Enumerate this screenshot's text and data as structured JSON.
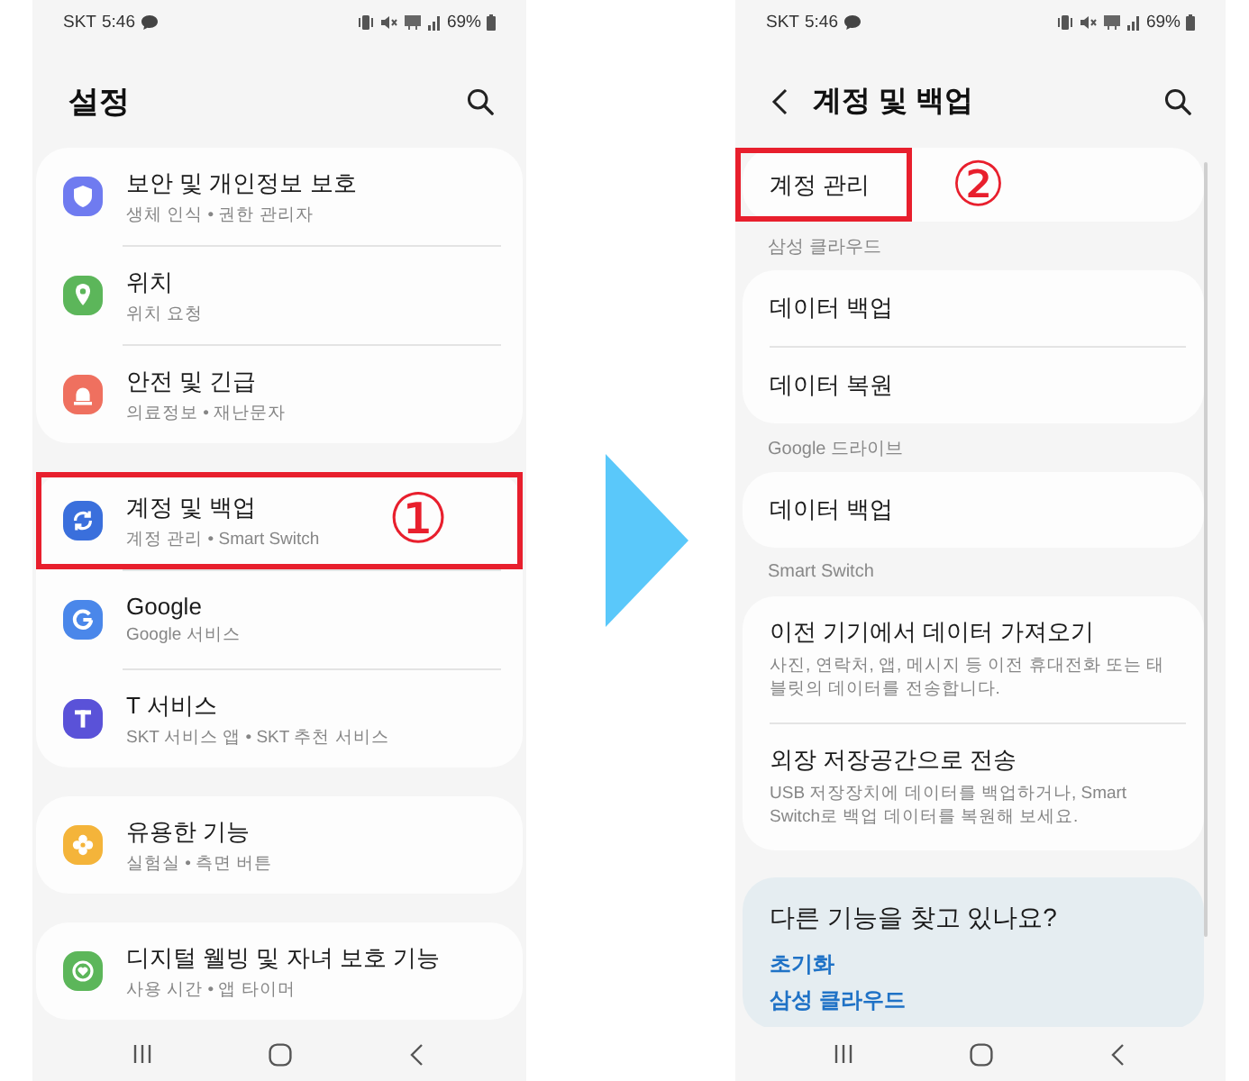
{
  "screens": [
    {
      "kind": "main",
      "status_bar": {
        "carrier": "SKT",
        "time": "5:46",
        "battery": "69%"
      },
      "title": "설정",
      "groups": [
        {
          "items": [
            {
              "title": "보안 및 개인정보 보호",
              "subtitle": "생체 인식 • 권한 관리자",
              "color": "#6f7bf0",
              "highlighted": false
            },
            {
              "title": "위치",
              "subtitle": "위치 요청",
              "color": "#5cb65a",
              "highlighted": false
            },
            {
              "title": "안전 및 긴급",
              "subtitle": "의료정보 • 재난문자",
              "color": "#ef705f",
              "highlighted": false
            }
          ]
        },
        {
          "items": [
            {
              "title": "계정 및 백업",
              "subtitle": "계정 관리 • Smart Switch",
              "color": "#3a6fdc",
              "highlighted": true,
              "step": "①"
            },
            {
              "title": "Google",
              "subtitle": "Google 서비스",
              "color": "#4a87ea",
              "highlighted": false
            },
            {
              "title": "T 서비스",
              "subtitle": "SKT 서비스 앱 • SKT 추천 서비스",
              "color": "#5a52d8",
              "highlighted": false
            }
          ]
        },
        {
          "items": [
            {
              "title": "유용한 기능",
              "subtitle": "실험실 • 측면 버튼",
              "color": "#f4b43a",
              "highlighted": false
            }
          ]
        },
        {
          "items": [
            {
              "title": "디지털 웰빙 및 자녀 보호 기능",
              "subtitle": "사용 시간 • 앱 타이머",
              "color": "#5cb65a",
              "highlighted": false
            }
          ]
        }
      ]
    },
    {
      "kind": "detail",
      "status_bar": {
        "carrier": "SKT",
        "time": "5:46",
        "battery": "69%"
      },
      "title": "계정 및 백업",
      "groups": [
        {
          "items": [
            {
              "title": "계정 관리",
              "highlighted": true,
              "step": "②"
            }
          ]
        },
        {
          "label": "삼성 클라우드",
          "items": [
            {
              "title": "데이터 백업",
              "highlighted": false
            },
            {
              "title": "데이터 복원",
              "highlighted": false
            }
          ]
        },
        {
          "label": "Google 드라이브",
          "items": [
            {
              "title": "데이터 백업",
              "highlighted": false
            }
          ]
        },
        {
          "label": "Smart Switch",
          "items": [
            {
              "title": "이전 기기에서 데이터 가져오기",
              "subtitle": "사진, 연락처, 앱, 메시지 등 이전 휴대전화 또는 태블릿의 데이터를 전송합니다.",
              "highlighted": false
            },
            {
              "title": "외장 저장공간으로 전송",
              "subtitle": "USB 저장장치에 데이터를 백업하거나, Smart Switch로 백업 데이터를 복원해 보세요.",
              "highlighted": false
            }
          ]
        }
      ],
      "suggestions": {
        "title": "다른 기능을 찾고 있나요?",
        "links": [
          "초기화",
          "삼성 클라우드"
        ]
      }
    }
  ]
}
